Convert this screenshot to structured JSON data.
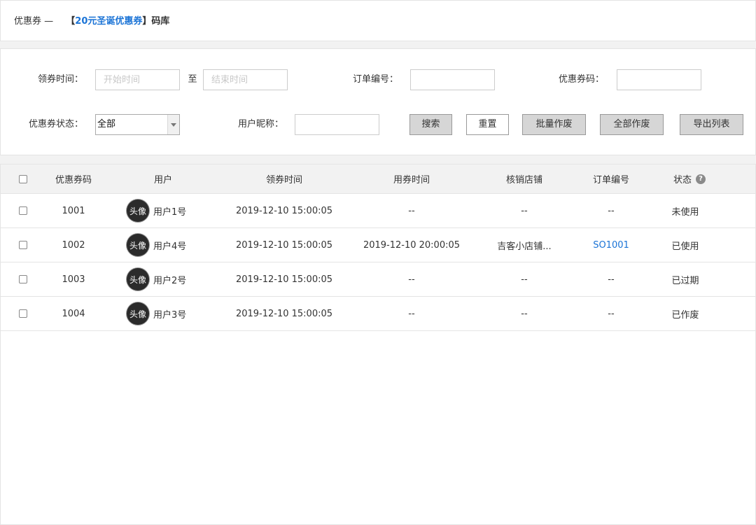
{
  "header": {
    "prefix": "优惠券 —",
    "open_bracket": "【",
    "coupon_name": "20元圣诞优惠券",
    "close_bracket": "】",
    "suffix": "码库"
  },
  "filters": {
    "claim_time_label": "领券时间：",
    "start_placeholder": "开始时间",
    "to_label": "至",
    "end_placeholder": "结束时间",
    "order_no_label": "订单编号：",
    "coupon_code_label": "优惠券码：",
    "status_label": "优惠券状态：",
    "status_value": "全部",
    "nickname_label": "用户昵称：",
    "search_button": "搜索",
    "reset_button": "重置",
    "batch_void_button": "批量作废",
    "void_all_button": "全部作废",
    "export_button": "导出列表"
  },
  "table": {
    "columns": {
      "code": "优惠券码",
      "user": "用户",
      "claim_time": "领券时间",
      "use_time": "用券时间",
      "store": "核销店铺",
      "order_no": "订单编号",
      "status": "状态"
    },
    "help_icon": "?",
    "rows": [
      {
        "code": "1001",
        "avatar": "头像",
        "user": "用户1号",
        "claim_time": "2019-12-10 15:00:05",
        "use_time": "--",
        "store": "--",
        "order_no": "--",
        "status": "未使用"
      },
      {
        "code": "1002",
        "avatar": "头像",
        "user": "用户4号",
        "claim_time": "2019-12-10 15:00:05",
        "use_time": "2019-12-10 20:00:05",
        "store": "吉客小店铺...",
        "order_no": "SO1001",
        "status": "已使用"
      },
      {
        "code": "1003",
        "avatar": "头像",
        "user": "用户2号",
        "claim_time": "2019-12-10 15:00:05",
        "use_time": "--",
        "store": "--",
        "order_no": "--",
        "status": "已过期"
      },
      {
        "code": "1004",
        "avatar": "头像",
        "user": "用户3号",
        "claim_time": "2019-12-10 15:00:05",
        "use_time": "--",
        "store": "--",
        "order_no": "--",
        "status": "已作废"
      }
    ]
  },
  "colors": {
    "accent": "#1a73d6",
    "avatar_bg": "#2b2b2b",
    "button_bg": "#d6d6d6"
  }
}
